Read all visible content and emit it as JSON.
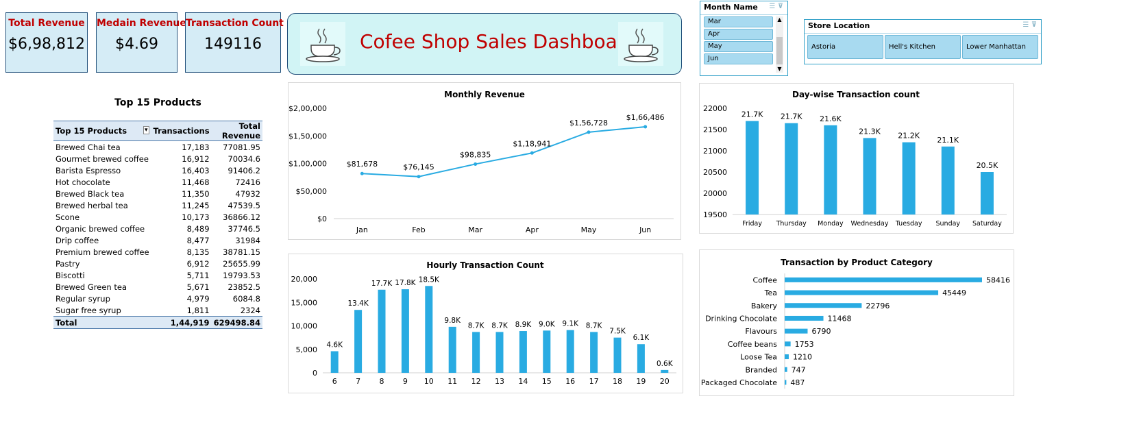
{
  "kpis": {
    "total_revenue": {
      "label": "Total Revenue",
      "value": "$6,98,812"
    },
    "median_revenue": {
      "label": "Medain Revenue",
      "value": "$4.69"
    },
    "transaction_count": {
      "label": "Transaction Count",
      "value": "149116"
    }
  },
  "dashboard_title": "Cofee Shop Sales Dashboard",
  "month_slicer": {
    "title": "Month Name",
    "items": [
      "Mar",
      "Apr",
      "May",
      "Jun"
    ]
  },
  "store_slicer": {
    "title": "Store Location",
    "items": [
      "Astoria",
      "Hell's Kitchen",
      "Lower Manhattan"
    ]
  },
  "colors": {
    "accent": "#29abe2",
    "kpi_label": "#c00000",
    "kpi_bg": "#d5ecf6",
    "banner_bg": "#d1f4f5"
  },
  "icons": [
    "coffee-cup-icon"
  ],
  "top15": {
    "title": "Top 15 Products",
    "headers": [
      "Top 15 Products",
      "Transactions",
      "Total Revenue"
    ],
    "rows": [
      [
        "Brewed Chai tea",
        "17,183",
        "77081.95"
      ],
      [
        "Gourmet brewed coffee",
        "16,912",
        "70034.6"
      ],
      [
        "Barista Espresso",
        "16,403",
        "91406.2"
      ],
      [
        "Hot chocolate",
        "11,468",
        "72416"
      ],
      [
        "Brewed Black tea",
        "11,350",
        "47932"
      ],
      [
        "Brewed herbal tea",
        "11,245",
        "47539.5"
      ],
      [
        "Scone",
        "10,173",
        "36866.12"
      ],
      [
        "Organic brewed coffee",
        "8,489",
        "37746.5"
      ],
      [
        "Drip coffee",
        "8,477",
        "31984"
      ],
      [
        "Premium brewed coffee",
        "8,135",
        "38781.15"
      ],
      [
        "Pastry",
        "6,912",
        "25655.99"
      ],
      [
        "Biscotti",
        "5,711",
        "19793.53"
      ],
      [
        "Brewed Green tea",
        "5,671",
        "23852.5"
      ],
      [
        "Regular syrup",
        "4,979",
        "6084.8"
      ],
      [
        "Sugar free syrup",
        "1,811",
        "2324"
      ]
    ],
    "total": [
      "Total",
      "1,44,919",
      "629498.84"
    ]
  },
  "chart_data": [
    {
      "id": "monthly",
      "type": "line",
      "title": "Monthly Revenue",
      "categories": [
        "Jan",
        "Feb",
        "Mar",
        "Apr",
        "May",
        "Jun"
      ],
      "values": [
        81678,
        76145,
        98835,
        118941,
        156728,
        166486
      ],
      "labels": [
        "$81,678",
        "$76,145",
        "$98,835",
        "$1,18,941",
        "$1,56,728",
        "$1,66,486"
      ],
      "yticks": [
        "$0",
        "$50,000",
        "$1,00,000",
        "$1,50,000",
        "$2,00,000"
      ],
      "ylim": [
        0,
        200000
      ]
    },
    {
      "id": "daywise",
      "type": "bar",
      "title": "Day-wise Transaction count",
      "categories": [
        "Friday",
        "Thursday",
        "Monday",
        "Wednesday",
        "Tuesday",
        "Sunday",
        "Saturday"
      ],
      "values": [
        21700,
        21650,
        21600,
        21300,
        21200,
        21100,
        20500
      ],
      "labels": [
        "21.7K",
        "21.7K",
        "21.6K",
        "21.3K",
        "21.2K",
        "21.1K",
        "20.5K"
      ],
      "yticks": [
        "19500",
        "20000",
        "20500",
        "21000",
        "21500",
        "22000"
      ],
      "ylim": [
        19500,
        22000
      ]
    },
    {
      "id": "hourly",
      "type": "bar",
      "title": "Hourly Transaction Count",
      "categories": [
        "6",
        "7",
        "8",
        "9",
        "10",
        "11",
        "12",
        "13",
        "14",
        "15",
        "16",
        "17",
        "18",
        "19",
        "20"
      ],
      "values": [
        4600,
        13400,
        17700,
        17800,
        18500,
        9800,
        8700,
        8700,
        8900,
        9000,
        9100,
        8700,
        7500,
        6100,
        600
      ],
      "labels": [
        "4.6K",
        "13.4K",
        "17.7K",
        "17.8K",
        "18.5K",
        "9.8K",
        "8.7K",
        "8.7K",
        "8.9K",
        "9.0K",
        "9.1K",
        "8.7K",
        "7.5K",
        "6.1K",
        "0.6K"
      ],
      "yticks": [
        "0",
        "5,000",
        "10,000",
        "15,000",
        "20,000"
      ],
      "ylim": [
        0,
        20000
      ]
    },
    {
      "id": "category",
      "type": "bar",
      "orientation": "horizontal",
      "title": "Transaction by Product Category",
      "categories": [
        "Coffee",
        "Tea",
        "Bakery",
        "Drinking Chocolate",
        "Flavours",
        "Coffee beans",
        "Loose Tea",
        "Branded",
        "Packaged Chocolate"
      ],
      "values": [
        58416,
        45449,
        22796,
        11468,
        6790,
        1753,
        1210,
        747,
        487
      ],
      "labels": [
        "58416",
        "45449",
        "22796",
        "11468",
        "6790",
        "1753",
        "1210",
        "747",
        "487"
      ]
    }
  ]
}
